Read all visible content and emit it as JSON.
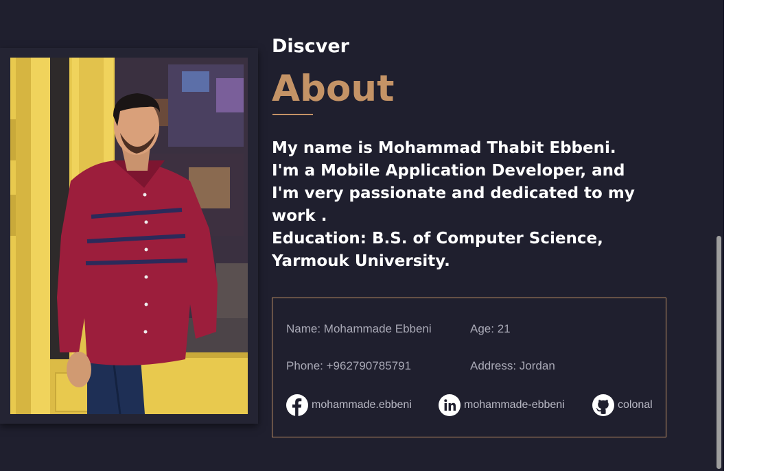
{
  "about": {
    "subtitle": "Discver",
    "title": "About",
    "bio_lines": [
      "My name is Mohammad Thabit Ebbeni.",
      "I'm a Mobile Application Developer, and",
      "I'm very passionate and dedicated to my",
      "work .",
      "Education: B.S. of Computer Science,",
      "Yarmouk University."
    ]
  },
  "info": {
    "name": "Name: Mohammade Ebbeni",
    "age": "Age: 21",
    "phone": "Phone: +962790785791",
    "address": "Address: Jordan"
  },
  "social": [
    {
      "icon": "facebook-icon",
      "label": "mohammade.ebbeni"
    },
    {
      "icon": "linkedin-icon",
      "label": "mohammade-ebbeni"
    },
    {
      "icon": "github-icon",
      "label": "colonal"
    }
  ],
  "colors": {
    "background": "#1f1f2e",
    "accent": "#c49366",
    "text": "#ffffff",
    "muted_text": "#a9a9b6"
  }
}
